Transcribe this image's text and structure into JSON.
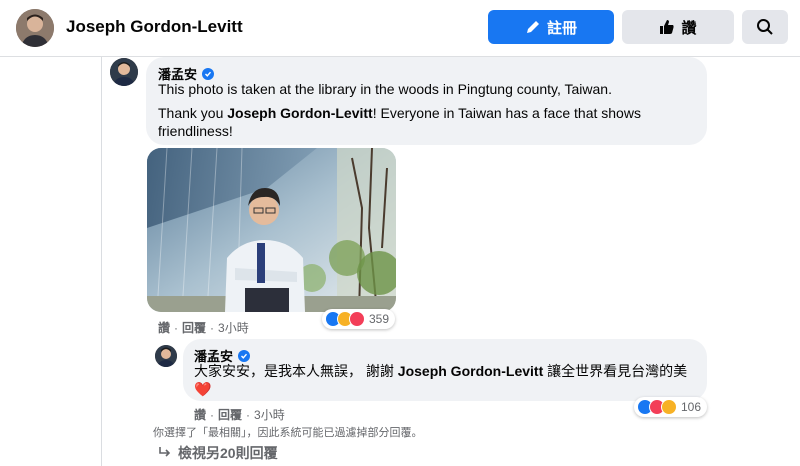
{
  "header": {
    "page_name": "Joseph Gordon-Levitt",
    "comment_button": "註冊",
    "like_button": "讚"
  },
  "comment": {
    "author": "潘孟安",
    "paragraph1": "This photo is taken at the library in the woods in Pingtung county, Taiwan.",
    "paragraph2_prefix": "Thank you ",
    "paragraph2_bold": "Joseph Gordon-Levitt",
    "paragraph2_suffix": "! Everyone in Taiwan has a face that shows friendliness!",
    "like": "讚",
    "reply": "回覆",
    "time": "3小時",
    "reaction_count": "359"
  },
  "reply": {
    "author": "潘孟安",
    "text_prefix": "大家安安，是我本人無誤， 謝謝 ",
    "text_bold": "Joseph Gordon-Levitt",
    "text_suffix": " 讓全世界看見台灣的美",
    "heart": "❤️",
    "like": "讚",
    "reply": "回覆",
    "time": "3小時",
    "reaction_count": "106"
  },
  "filter_note": "你選擇了「最相關」，因此系統可能已過濾掉部分回覆。",
  "more_replies": "檢視另20則回覆",
  "colors": {
    "brand": "#1877f2",
    "like_blue": "#1877f2",
    "love_red": "#f33e58",
    "haha_yellow": "#f7b125"
  }
}
